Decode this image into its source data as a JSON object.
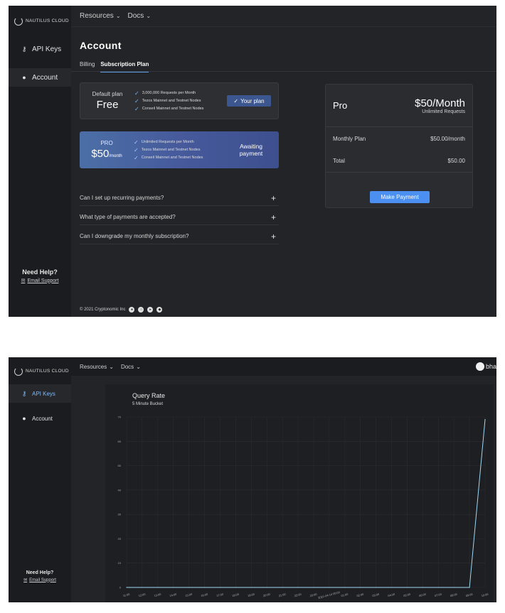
{
  "brand": {
    "name": "NAUTILUS CLOUD"
  },
  "topnav": {
    "resources": "Resources",
    "docs": "Docs",
    "user_label": "bha"
  },
  "sidebar": {
    "items": [
      {
        "label": "API Keys",
        "icon": "key-icon"
      },
      {
        "label": "Account",
        "icon": "user-circle-icon"
      }
    ],
    "help_title": "Need Help?",
    "help_link": "Email Support"
  },
  "account": {
    "title": "Account",
    "tabs": [
      {
        "label": "Billing"
      },
      {
        "label": "Subscription Plan",
        "active": true
      }
    ],
    "free_plan": {
      "label": "Default plan",
      "name": "Free",
      "features": [
        "3,000,000 Requests per Month",
        "Tezos Mainnet and Testnet Nodes",
        "Conseil Mainnet and Testnet Nodes"
      ],
      "badge": "Your plan"
    },
    "pro_plan": {
      "label": "PRO",
      "price": "$50",
      "per": "/month",
      "features": [
        "Unlimited Requests per Month",
        "Tezos Mainnet and Testnet Nodes",
        "Conseil Mainnet and Testnet Nodes"
      ],
      "status_line1": "Awaiting",
      "status_line2": "payment"
    },
    "faq": [
      {
        "q": "Can I set up recurring payments?"
      },
      {
        "q": "What type of payments are accepted?"
      },
      {
        "q": "Can I downgrade my monthly subscription?"
      }
    ],
    "summary": {
      "plan_name": "Pro",
      "price": "$50/Month",
      "price_sub": "Unlimited Requests",
      "rows": [
        {
          "label": "Monthly Plan",
          "value": "$50.00/month"
        },
        {
          "label": "Total",
          "value": "$50.00"
        }
      ],
      "button": "Make Payment"
    },
    "footer": "© 2021 Cryptonomic Inc"
  },
  "colors": {
    "accent": "#4b8ff0",
    "background": "#232427",
    "sidebar": "#1b1c1f",
    "line": "#9fd8f5"
  },
  "chart_data": {
    "type": "line",
    "title": "Query Rate",
    "subtitle": "5 Minute Bucket",
    "xlabel": "",
    "ylabel": "",
    "ylim": [
      0,
      70
    ],
    "yticks": [
      0,
      10,
      20,
      30,
      40,
      50,
      60,
      70
    ],
    "categories": [
      "11:00",
      "12:00",
      "13:00",
      "14:00",
      "15:00",
      "16:00",
      "17:00",
      "18:00",
      "19:00",
      "20:00",
      "21:00",
      "22:00",
      "23:00",
      "2021-04-14 00:00",
      "01:00",
      "02:00",
      "03:00",
      "04:00",
      "05:00",
      "06:00",
      "07:00",
      "08:00",
      "09:00",
      "10:00"
    ],
    "series": [
      {
        "values": [
          0,
          0,
          0,
          0,
          0,
          0,
          0,
          0,
          0,
          0,
          0,
          0,
          0,
          0,
          0,
          0,
          0,
          0,
          0,
          0,
          0,
          0,
          0,
          69
        ]
      }
    ],
    "grid": true
  }
}
